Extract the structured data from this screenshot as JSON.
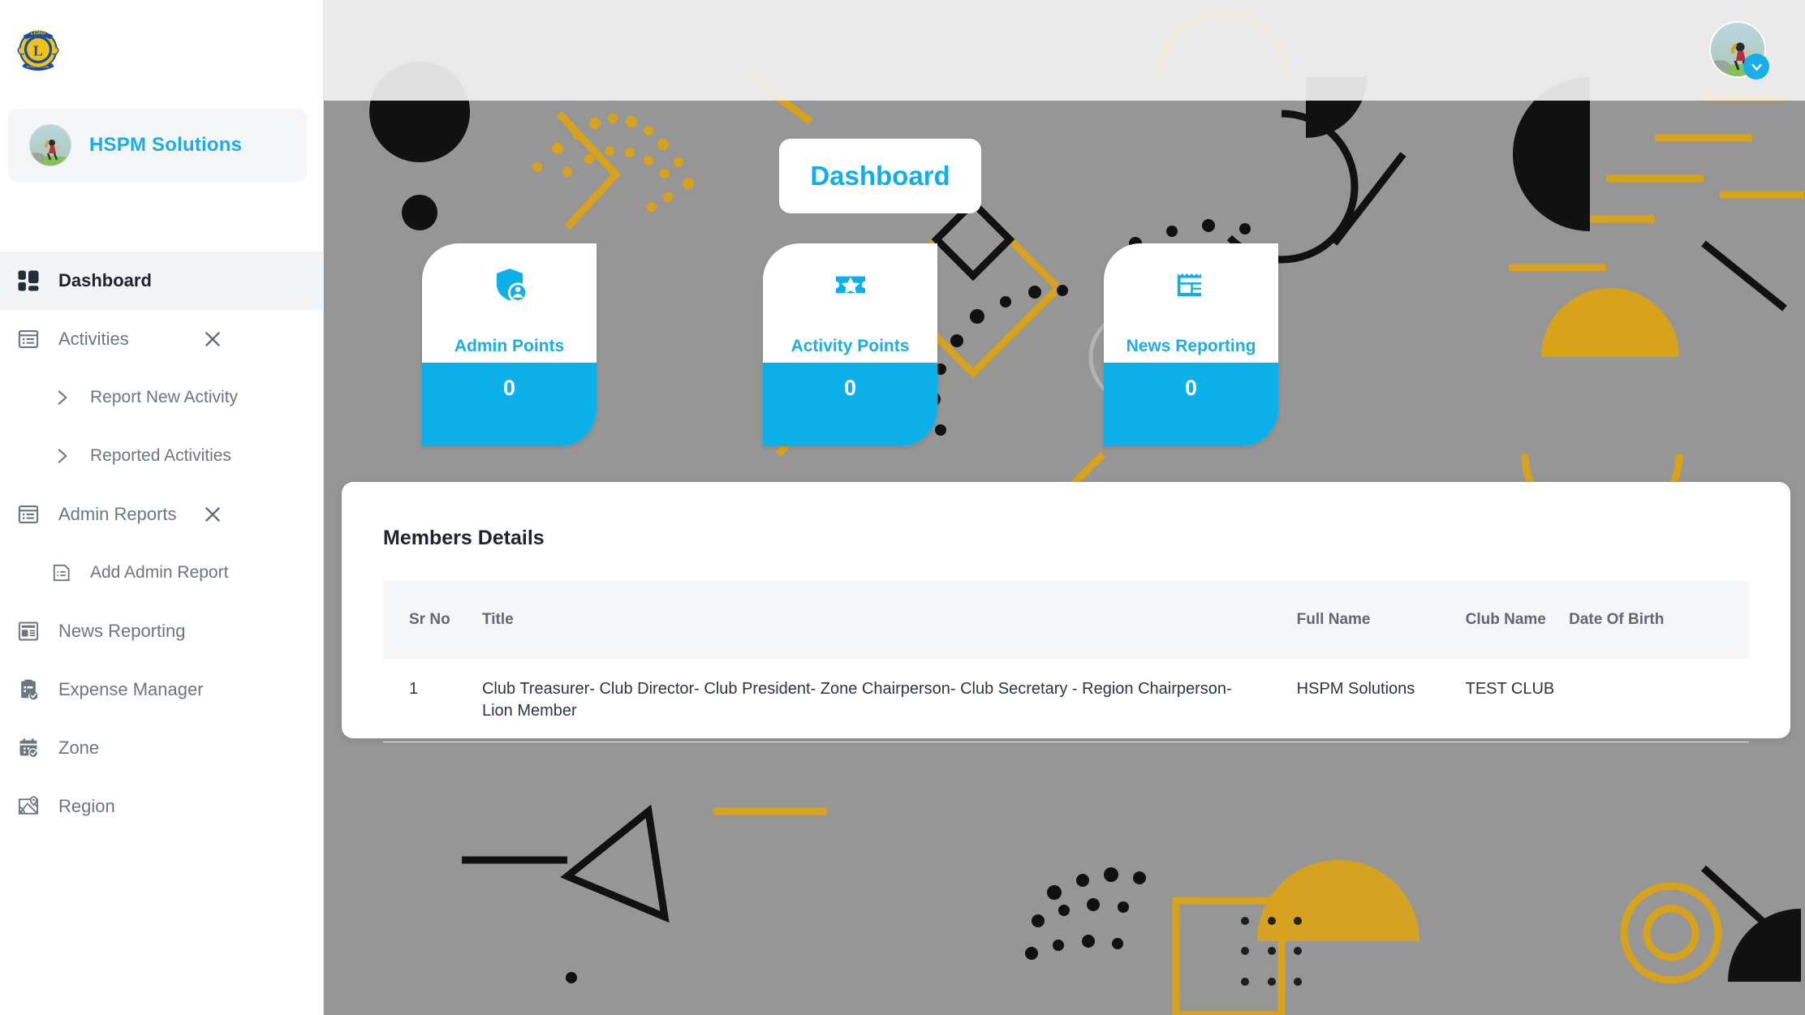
{
  "brand": {
    "logo_alt": "lions-international-logo"
  },
  "profile": {
    "name": "HSPM Solutions",
    "avatar_alt": "user-avatar"
  },
  "topbar": {
    "avatar_alt": "user-avatar",
    "caret": "chevron-down-icon"
  },
  "sidebar": {
    "items": [
      {
        "label": "Dashboard",
        "icon": "dashboard-grid-icon",
        "active": true,
        "closable": false,
        "sub": []
      },
      {
        "label": "Activities",
        "icon": "list-window-icon",
        "active": false,
        "closable": true,
        "sub": [
          {
            "label": "Report New Activity",
            "icon": "chevron-right-icon"
          },
          {
            "label": "Reported Activities",
            "icon": "chevron-right-icon"
          }
        ]
      },
      {
        "label": "Admin Reports",
        "icon": "list-window-icon",
        "active": false,
        "closable": true,
        "sub": [
          {
            "label": "Add Admin Report",
            "icon": "document-list-icon"
          }
        ]
      },
      {
        "label": "News Reporting",
        "icon": "newspaper-icon",
        "active": false,
        "closable": false,
        "sub": []
      },
      {
        "label": "Expense Manager",
        "icon": "clipboard-check-icon",
        "active": false,
        "closable": false,
        "sub": []
      },
      {
        "label": "Zone",
        "icon": "calendar-check-icon",
        "active": false,
        "closable": false,
        "sub": []
      },
      {
        "label": "Region",
        "icon": "map-pin-icon",
        "active": false,
        "closable": false,
        "sub": []
      }
    ]
  },
  "main": {
    "page_title": "Dashboard",
    "stat_cards": [
      {
        "label": "Admin Points",
        "value": "0",
        "icon": "shield-person-icon"
      },
      {
        "label": "Activity Points",
        "value": "0",
        "icon": "ticket-star-icon"
      },
      {
        "label": "News Reporting",
        "value": "0",
        "icon": "newspaper-icon"
      }
    ],
    "members": {
      "title": "Members Details",
      "columns": [
        "Sr No",
        "Title",
        "Full Name",
        "Club Name",
        "Date Of Birth"
      ],
      "rows": [
        {
          "sr": "1",
          "title": "Club Treasurer- Club Director- Club President- Zone Chairperson- Club Secretary - Region Chairperson- Lion Member",
          "full_name": "HSPM Solutions",
          "club_name": "TEST CLUB",
          "dob": ""
        }
      ]
    }
  },
  "colors": {
    "accent": "#0bb0e8",
    "accent_text": "#1badea",
    "bg_gray": "#969696",
    "pattern_gold": "#d9a21b",
    "pattern_black": "#111111",
    "sidebar_active": "#f2f4f6",
    "table_header": "#f4f6f8"
  }
}
